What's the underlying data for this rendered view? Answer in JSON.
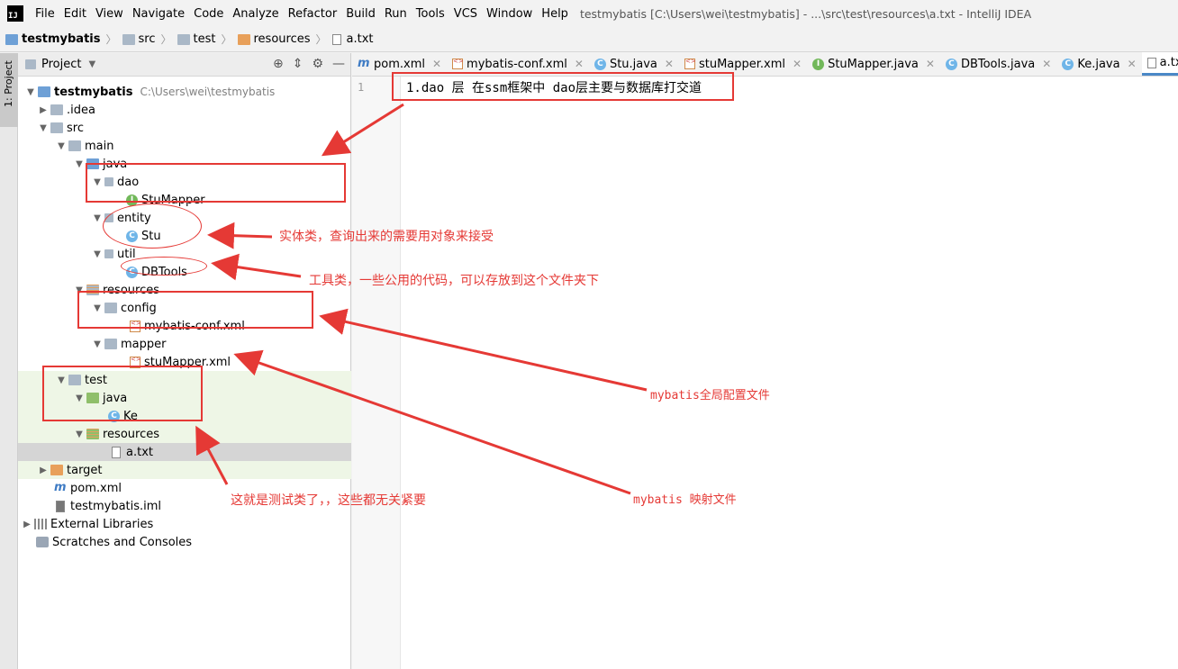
{
  "app": {
    "logo_text": "IJ",
    "menu": [
      "File",
      "Edit",
      "View",
      "Navigate",
      "Code",
      "Analyze",
      "Refactor",
      "Build",
      "Run",
      "Tools",
      "VCS",
      "Window",
      "Help"
    ],
    "window_title": "testmybatis [C:\\Users\\wei\\testmybatis] - ...\\src\\test\\resources\\a.txt - IntelliJ IDEA"
  },
  "breadcrumb": [
    "testmybatis",
    "src",
    "test",
    "resources",
    "a.txt"
  ],
  "left_strip": {
    "project_tab": "1: Project"
  },
  "project_panel": {
    "title": "Project",
    "tree": [
      {
        "label": "testmybatis",
        "hint": "C:\\Users\\wei\\testmybatis",
        "icon": "module-folder-icon"
      },
      {
        "label": ".idea",
        "icon": "folder-icon"
      },
      {
        "label": "src",
        "icon": "folder-icon"
      },
      {
        "label": "main",
        "icon": "folder-icon"
      },
      {
        "label": "java",
        "icon": "source-folder-icon"
      },
      {
        "label": "dao",
        "icon": "package-icon"
      },
      {
        "label": "StuMapper",
        "icon": "interface-icon"
      },
      {
        "label": "entity",
        "icon": "package-icon"
      },
      {
        "label": "Stu",
        "icon": "class-icon"
      },
      {
        "label": "util",
        "icon": "package-icon"
      },
      {
        "label": "DBTools",
        "icon": "class-icon"
      },
      {
        "label": "resources",
        "icon": "resources-folder-icon"
      },
      {
        "label": "config",
        "icon": "package-icon"
      },
      {
        "label": "mybatis-conf.xml",
        "icon": "xml-file-icon"
      },
      {
        "label": "mapper",
        "icon": "package-icon"
      },
      {
        "label": "stuMapper.xml",
        "icon": "xml-file-icon"
      },
      {
        "label": "test",
        "icon": "folder-icon"
      },
      {
        "label": "java",
        "icon": "test-source-folder-icon"
      },
      {
        "label": "Ke",
        "icon": "class-icon"
      },
      {
        "label": "resources",
        "icon": "test-resources-folder-icon"
      },
      {
        "label": "a.txt",
        "icon": "text-file-icon"
      },
      {
        "label": "target",
        "icon": "excluded-folder-icon"
      },
      {
        "label": "pom.xml",
        "icon": "maven-file-icon"
      },
      {
        "label": "testmybatis.iml",
        "icon": "iml-file-icon"
      },
      {
        "label": "External Libraries",
        "icon": "libraries-icon"
      },
      {
        "label": "Scratches and Consoles",
        "icon": "scratches-icon"
      }
    ]
  },
  "editor": {
    "tabs": [
      {
        "label": "pom.xml",
        "icon": "maven-file-icon"
      },
      {
        "label": "mybatis-conf.xml",
        "icon": "xml-file-icon"
      },
      {
        "label": "Stu.java",
        "icon": "class-icon"
      },
      {
        "label": "stuMapper.xml",
        "icon": "xml-file-icon"
      },
      {
        "label": "StuMapper.java",
        "icon": "interface-icon"
      },
      {
        "label": "DBTools.java",
        "icon": "class-icon"
      },
      {
        "label": "Ke.java",
        "icon": "class-icon"
      },
      {
        "label": "a.txt",
        "icon": "text-file-icon"
      }
    ],
    "active_tab": "a.txt",
    "line_number": "1",
    "content": "1.dao 层 在ssm框架中 dao层主要与数据库打交道"
  },
  "annotations": {
    "entity_note": "实体类，查询出来的需要用对象来接受",
    "util_note": "工具类，一些公用的代码，可以存放到这个文件夹下",
    "config_note": "mybatis全局配置文件",
    "mapper_note": "mybatis 映射文件",
    "test_note": "这就是测试类了，，这些都无关紧要"
  },
  "colors": {
    "annotation": "#e53935",
    "accent": "#4a88c7"
  }
}
